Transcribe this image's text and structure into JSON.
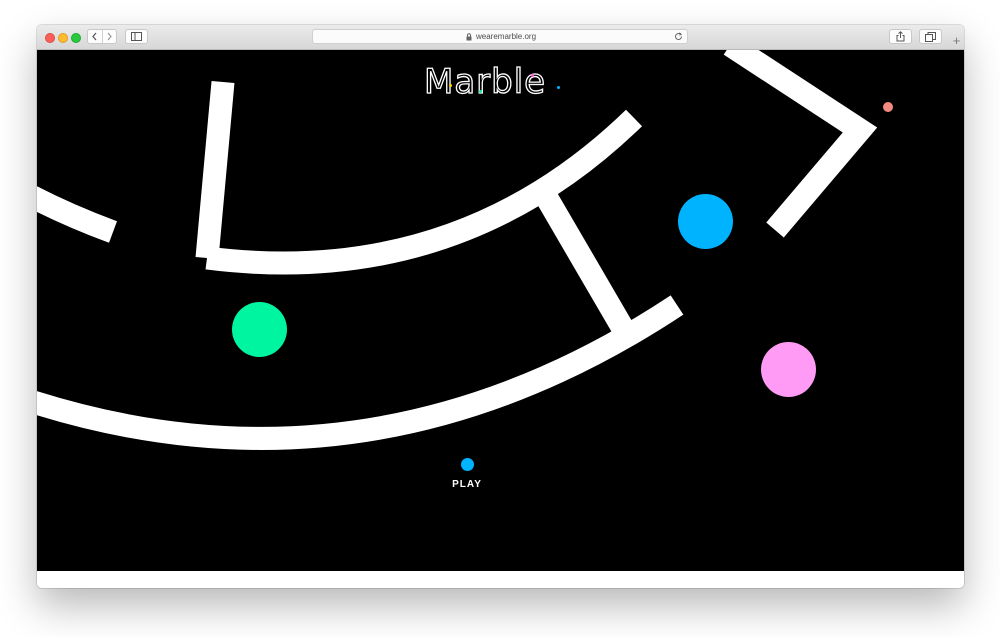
{
  "browser": {
    "url": "wearemarble.org",
    "icons": {
      "back": "chevron-left-icon",
      "forward": "chevron-right-icon",
      "sidebar": "sidebar-icon",
      "lock": "lock-icon",
      "reload": "reload-icon",
      "share": "share-icon",
      "tabs": "tabs-icon",
      "new_tab": "plus-icon"
    },
    "new_tab_label": "+"
  },
  "page": {
    "logo_text": "Marble",
    "play_label": "PLAY",
    "background": "#000000",
    "maze_color": "#ffffff"
  },
  "marbles": [
    {
      "name": "blue",
      "color": "#00b3ff"
    },
    {
      "name": "green",
      "color": "#00f5a0"
    },
    {
      "name": "pink",
      "color": "#ff9af5"
    },
    {
      "name": "salmon",
      "color": "#f28b82"
    },
    {
      "name": "play-blue",
      "color": "#00b3ff"
    }
  ],
  "logo_accent_colors": [
    "#ffd400",
    "#00f5a0",
    "#ff4fd8",
    "#00b3ff"
  ]
}
